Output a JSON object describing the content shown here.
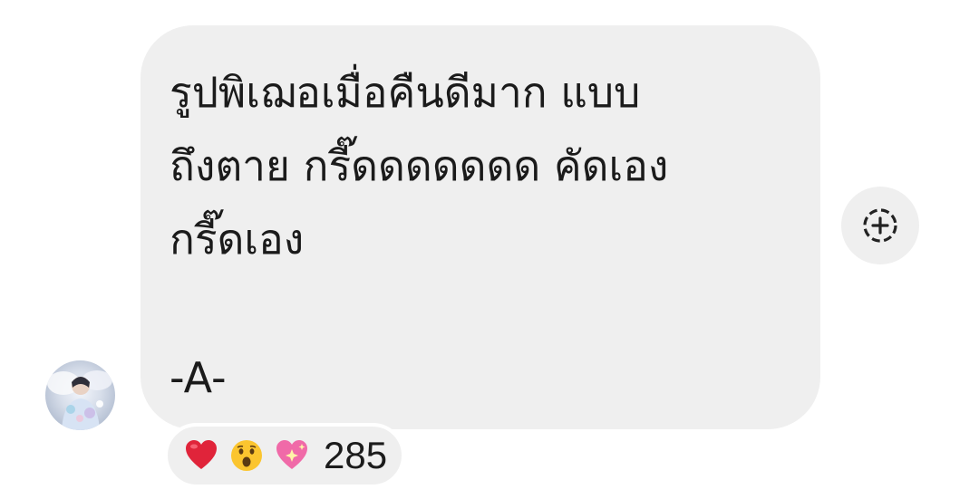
{
  "message": {
    "lines": [
      "รูปพิเฌอเมื่อคืนดีมาก แบบ",
      "ถึงตาย กรี๊ดดดดดดด คัดเอง",
      "กรี๊ดเอง"
    ],
    "signature": "-A-"
  },
  "reactions": {
    "emojis": [
      "red-heart",
      "astonished-face",
      "sparkling-heart"
    ],
    "count": "285"
  },
  "icons": {
    "add_reaction": "add-reaction-icon",
    "avatar": "avatar-image"
  },
  "colors": {
    "bubble": "#efefef",
    "text": "#1b1b1b",
    "background": "#ffffff"
  }
}
